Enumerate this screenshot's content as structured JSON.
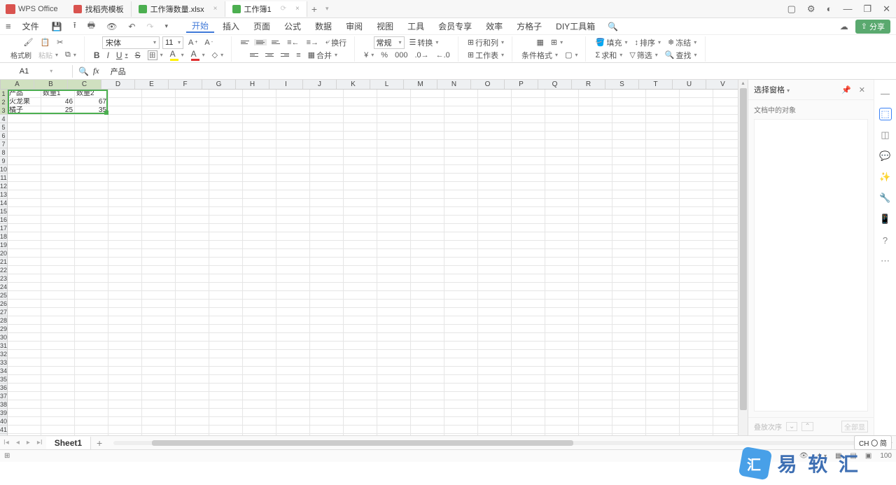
{
  "app_name": "WPS Office",
  "tabs": [
    {
      "icon": "red",
      "label": "找稻壳模板"
    },
    {
      "icon": "green",
      "label": "工作簿数量.xlsx"
    },
    {
      "icon": "green",
      "label": "工作簿1"
    }
  ],
  "menubar": {
    "file": "文件",
    "items": [
      "开始",
      "插入",
      "页面",
      "公式",
      "数据",
      "审阅",
      "视图",
      "工具",
      "会员专享",
      "效率",
      "方格子",
      "DIY工具箱"
    ]
  },
  "share_label": "分享",
  "ribbon": {
    "format_painter": "格式刷",
    "paste": "粘贴",
    "font": "宋体",
    "font_size": "11",
    "wrap": "换行",
    "number_format": "常规",
    "convert": "转换",
    "rowscols": "行和列",
    "worksheet": "工作表",
    "cond_fmt": "条件格式",
    "fill": "填充",
    "sort": "排序",
    "freeze": "冻结",
    "sum": "求和",
    "filter": "筛选",
    "find": "查找",
    "merge": "合并"
  },
  "cell_ref": "A1",
  "formula_value": "产品",
  "columns": [
    "A",
    "B",
    "C",
    "D",
    "E",
    "F",
    "G",
    "H",
    "I",
    "J",
    "K",
    "L",
    "M",
    "N",
    "O",
    "P",
    "Q",
    "R",
    "S",
    "T",
    "U",
    "V"
  ],
  "row_count": 43,
  "cells": {
    "A1": "产品",
    "B1": "数量1",
    "C1": "数量2",
    "A2": "火龙果",
    "B2": "46",
    "C2": "67",
    "A3": "橘子",
    "B3": "25",
    "C3": "35"
  },
  "selection": {
    "top": 0,
    "left": 0,
    "rows": 3,
    "cols": 3
  },
  "right_pane": {
    "title": "选择窗格",
    "subtitle": "文档中的对象",
    "footer_label": "叠放次序",
    "all": "全部显"
  },
  "sheet_tab": "Sheet1",
  "zoom": "100",
  "ime": "CH 〇 简",
  "watermark": "易 软 汇"
}
